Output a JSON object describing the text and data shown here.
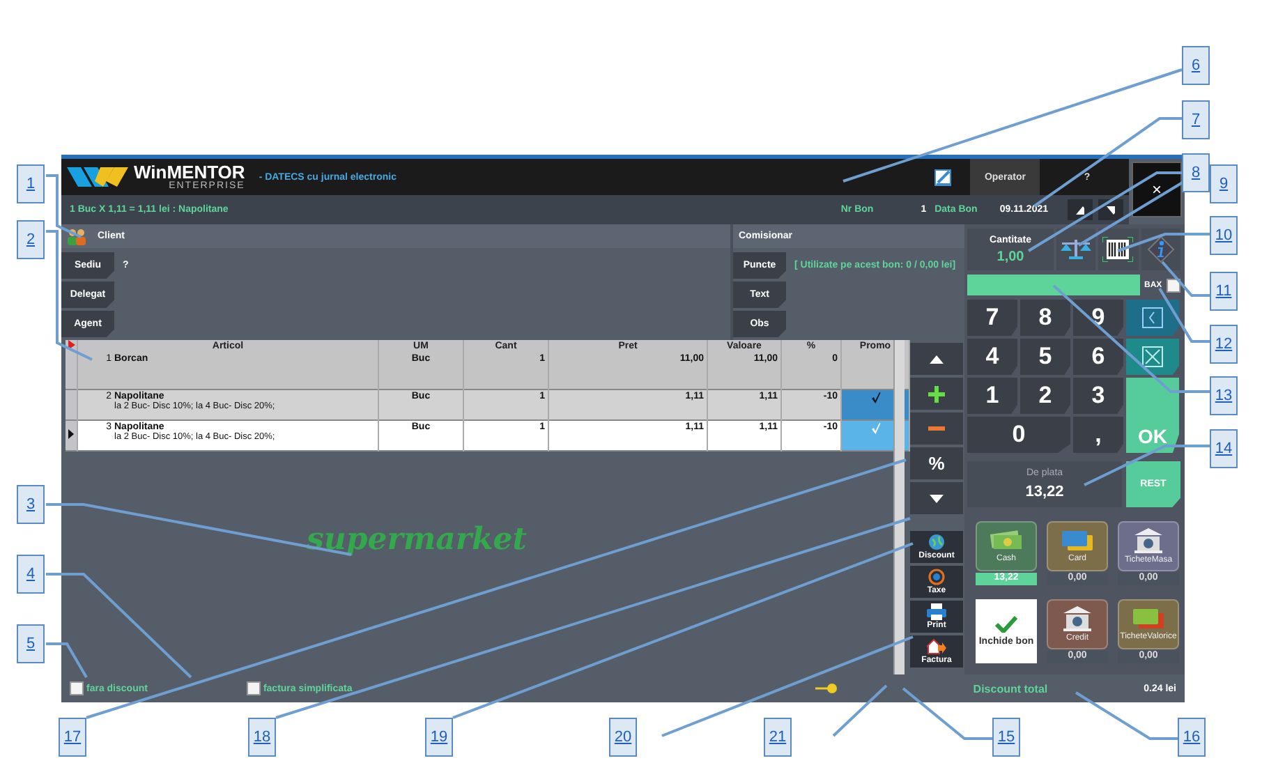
{
  "callouts": [
    {
      "label": "1"
    },
    {
      "label": "2"
    },
    {
      "label": "3"
    },
    {
      "label": "4"
    },
    {
      "label": "5"
    },
    {
      "label": "6"
    },
    {
      "label": "7"
    },
    {
      "label": "8"
    },
    {
      "label": "9"
    },
    {
      "label": "10"
    },
    {
      "label": "11"
    },
    {
      "label": "12"
    },
    {
      "label": "13"
    },
    {
      "label": "14"
    },
    {
      "label": "17"
    },
    {
      "label": "18"
    },
    {
      "label": "19"
    },
    {
      "label": "20"
    },
    {
      "label": "21"
    },
    {
      "label": "15"
    },
    {
      "label": "16"
    }
  ],
  "header": {
    "logo_title": "WinMENTOR",
    "logo_subtitle": "ENTERPRISE",
    "device": "- DATECS cu jurnal electronic",
    "operator_tab": "Operator",
    "help": "?",
    "close": "×"
  },
  "status": {
    "last_item": "1 Buc X 1,11  = 1,11 lei : Napolitane",
    "nr_bon_label": "Nr Bon",
    "nr_bon": "1",
    "data_bon_label": "Data Bon",
    "data_bon": "09.11.2021"
  },
  "client": {
    "title": "Client",
    "buttons": [
      {
        "label": "Sediu",
        "value": "?"
      },
      {
        "label": "Delegat"
      },
      {
        "label": "Agent"
      }
    ]
  },
  "comisionar": {
    "title": "Comisionar",
    "buttons": [
      {
        "label": "Puncte"
      },
      {
        "label": "Text"
      },
      {
        "label": "Obs"
      }
    ],
    "points_info": "[ Utilizate pe acest bon: 0 / 0,00 lei]"
  },
  "table": {
    "columns": [
      "Articol",
      "UM",
      "Cant",
      "Pret",
      "Valoare",
      "%",
      "Promo"
    ],
    "rows": [
      {
        "nr": "1",
        "name": "Borcan",
        "um": "Buc",
        "cant": "1",
        "pret": "11,00",
        "valoare": "11,00",
        "pct": "0",
        "promo": false,
        "selected": false
      },
      {
        "nr": "2",
        "name": "Napolitane",
        "detail": "la 2 Buc- Disc 10%; la 4 Buc- Disc 20%;",
        "um": "Buc",
        "cant": "1",
        "pret": "1,11",
        "valoare": "1,11",
        "pct": "-10",
        "promo": true,
        "selected": false
      },
      {
        "nr": "3",
        "name": "Napolitane",
        "detail": "la 2 Buc- Disc 10%; la 4 Buc- Disc 20%;",
        "um": "Buc",
        "cant": "1",
        "pret": "1,11",
        "valoare": "1,11",
        "pct": "-10",
        "promo": true,
        "selected": true
      }
    ]
  },
  "side_buttons": [
    {
      "kind": "up"
    },
    {
      "kind": "plus",
      "color": "#66dd44"
    },
    {
      "kind": "minus",
      "color": "#ee7733"
    },
    {
      "kind": "text",
      "label": "%"
    },
    {
      "kind": "down"
    }
  ],
  "actions": [
    {
      "kind": "discount",
      "label": "Discount"
    },
    {
      "kind": "tax",
      "label": "Taxe"
    },
    {
      "kind": "print",
      "label": "Print"
    },
    {
      "kind": "invoice",
      "label": "Factura"
    }
  ],
  "watermark": "supermarket",
  "options": [
    {
      "label": "fara discount",
      "checked": false
    },
    {
      "label": "factura simplificata",
      "checked": false
    }
  ],
  "footer": {
    "label": "Discount total",
    "value": "0.24 lei"
  },
  "quantity": {
    "label": "Cantitate",
    "value": "1,00"
  },
  "bax": {
    "label": "BAX",
    "checked": false
  },
  "keypad": [
    "7",
    "8",
    "9",
    "4",
    "5",
    "6",
    "1",
    "2",
    "3",
    "0",
    ","
  ],
  "ok": "OK",
  "payment": {
    "label": "De plata",
    "value": "13,22",
    "rest": "REST"
  },
  "tenders": [
    {
      "kind": "cash",
      "label": "Cash",
      "amount": "13,22",
      "selected": true,
      "color": "#4d7a5a"
    },
    {
      "kind": "card",
      "label": "Card",
      "amount": "0,00",
      "selected": false,
      "color": "#7d6e4a"
    },
    {
      "kind": "bank",
      "label": "TicheteMasa",
      "amount": "0,00",
      "selected": false,
      "color": "#6c6e8c"
    },
    {
      "kind": "close",
      "label": "Inchide bon"
    },
    {
      "kind": "bank",
      "label": "Credit",
      "amount": "0,00",
      "selected": false,
      "color": "#7e5a4e"
    },
    {
      "kind": "voucher",
      "label": "TicheteValorice",
      "amount": "0,00",
      "selected": false,
      "color": "#7d6e4a"
    }
  ]
}
